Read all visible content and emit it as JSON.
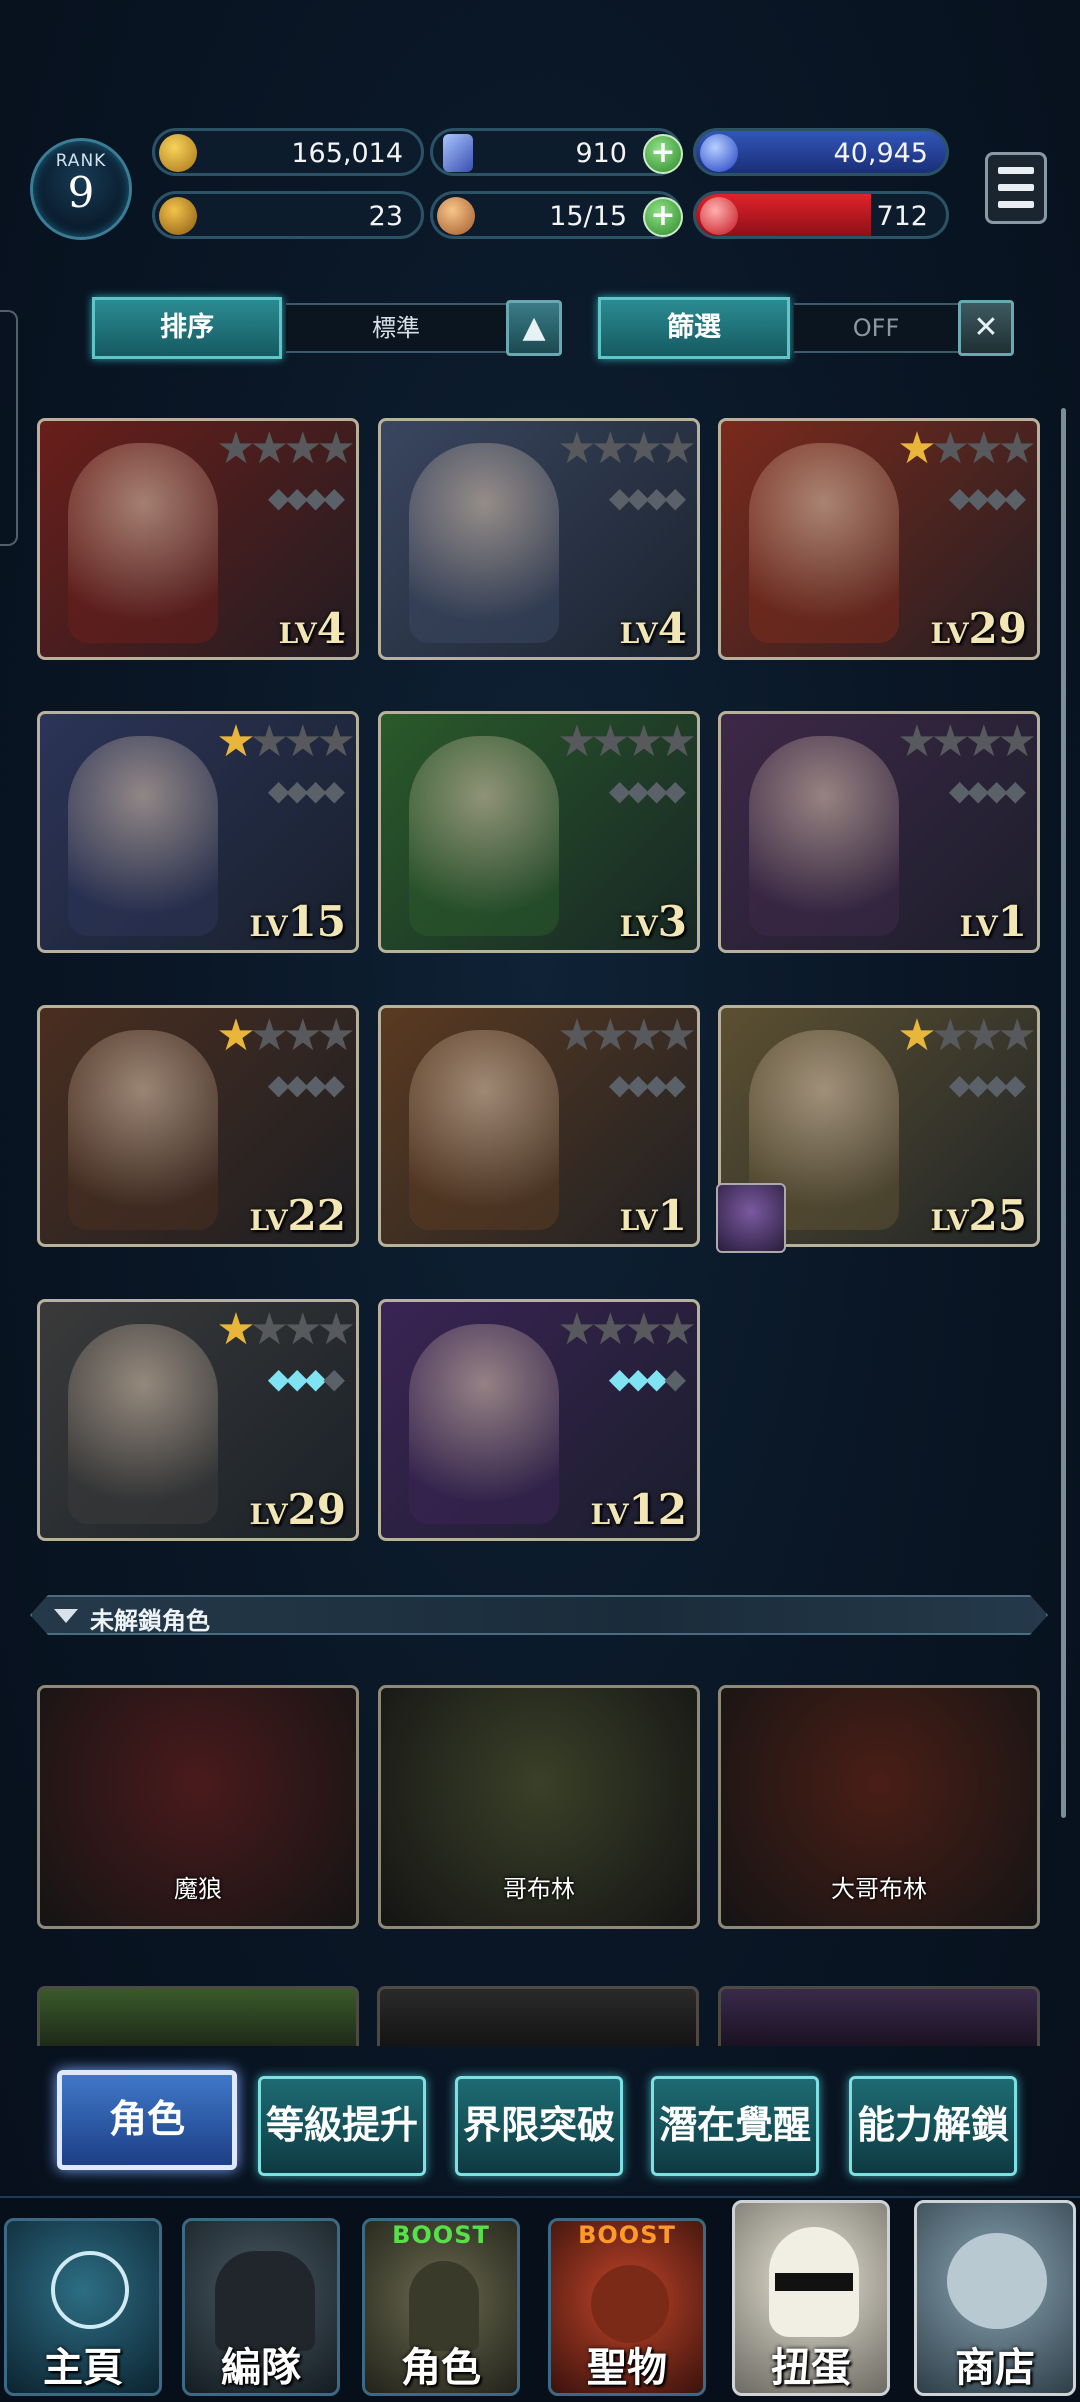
{
  "header": {
    "rank_label": "RANK",
    "rank_value": "9",
    "gold": "165,014",
    "crystal": "910",
    "blue_orb": "40,945",
    "trophy": "23",
    "stamina": "15/15",
    "red_orb": "712",
    "red_orb_fill": 0.7
  },
  "controls": {
    "sort_label": "排序",
    "sort_value": "標準",
    "filter_label": "篩選",
    "filter_value": "OFF"
  },
  "characters": [
    {
      "lv_prefix": "LV",
      "level": "4",
      "stars": 0,
      "gems": 0,
      "bg": "#6a1e1a"
    },
    {
      "lv_prefix": "LV",
      "level": "4",
      "stars": 0,
      "gems": 0,
      "bg": "#3a4660"
    },
    {
      "lv_prefix": "LV",
      "level": "29",
      "stars": 1,
      "gems": 0,
      "bg": "#7a2a1c"
    },
    {
      "lv_prefix": "LV",
      "level": "15",
      "stars": 1,
      "gems": 0,
      "bg": "#2c3458"
    },
    {
      "lv_prefix": "LV",
      "level": "3",
      "stars": 0,
      "gems": 0,
      "bg": "#2a5a2a"
    },
    {
      "lv_prefix": "LV",
      "level": "1",
      "stars": 0,
      "gems": 0,
      "bg": "#3e2848"
    },
    {
      "lv_prefix": "LV",
      "level": "22",
      "stars": 1,
      "gems": 0,
      "bg": "#4a2e20"
    },
    {
      "lv_prefix": "LV",
      "level": "1",
      "stars": 0,
      "gems": 0,
      "bg": "#5a3a22"
    },
    {
      "lv_prefix": "LV",
      "level": "25",
      "stars": 1,
      "gems": 0,
      "bg": "#5c5032"
    },
    {
      "lv_prefix": "LV",
      "level": "29",
      "stars": 1,
      "gems": 3,
      "bg": "#3a3a3a"
    },
    {
      "lv_prefix": "LV",
      "level": "12",
      "stars": 0,
      "gems": 3,
      "bg": "#3a2454"
    }
  ],
  "locked_section_label": "未解鎖角色",
  "locked_characters": [
    {
      "name": "魔狼",
      "bg": "#4a1a1c"
    },
    {
      "name": "哥布林",
      "bg": "#3a4028"
    },
    {
      "name": "大哥布林",
      "bg": "#4a1e16"
    }
  ],
  "tabs": [
    "角色",
    "等級提升",
    "界限突破",
    "潛在覺醒",
    "能力解鎖"
  ],
  "nav": {
    "home": "主頁",
    "team": "編隊",
    "character": "角色",
    "relic": "聖物",
    "gacha": "扭蛋",
    "shop": "商店",
    "boost_character": "BOOST",
    "boost_relic": "BOOST"
  },
  "colors": {
    "boost_green": "#57e04a",
    "boost_orange": "#ff9a2a"
  }
}
